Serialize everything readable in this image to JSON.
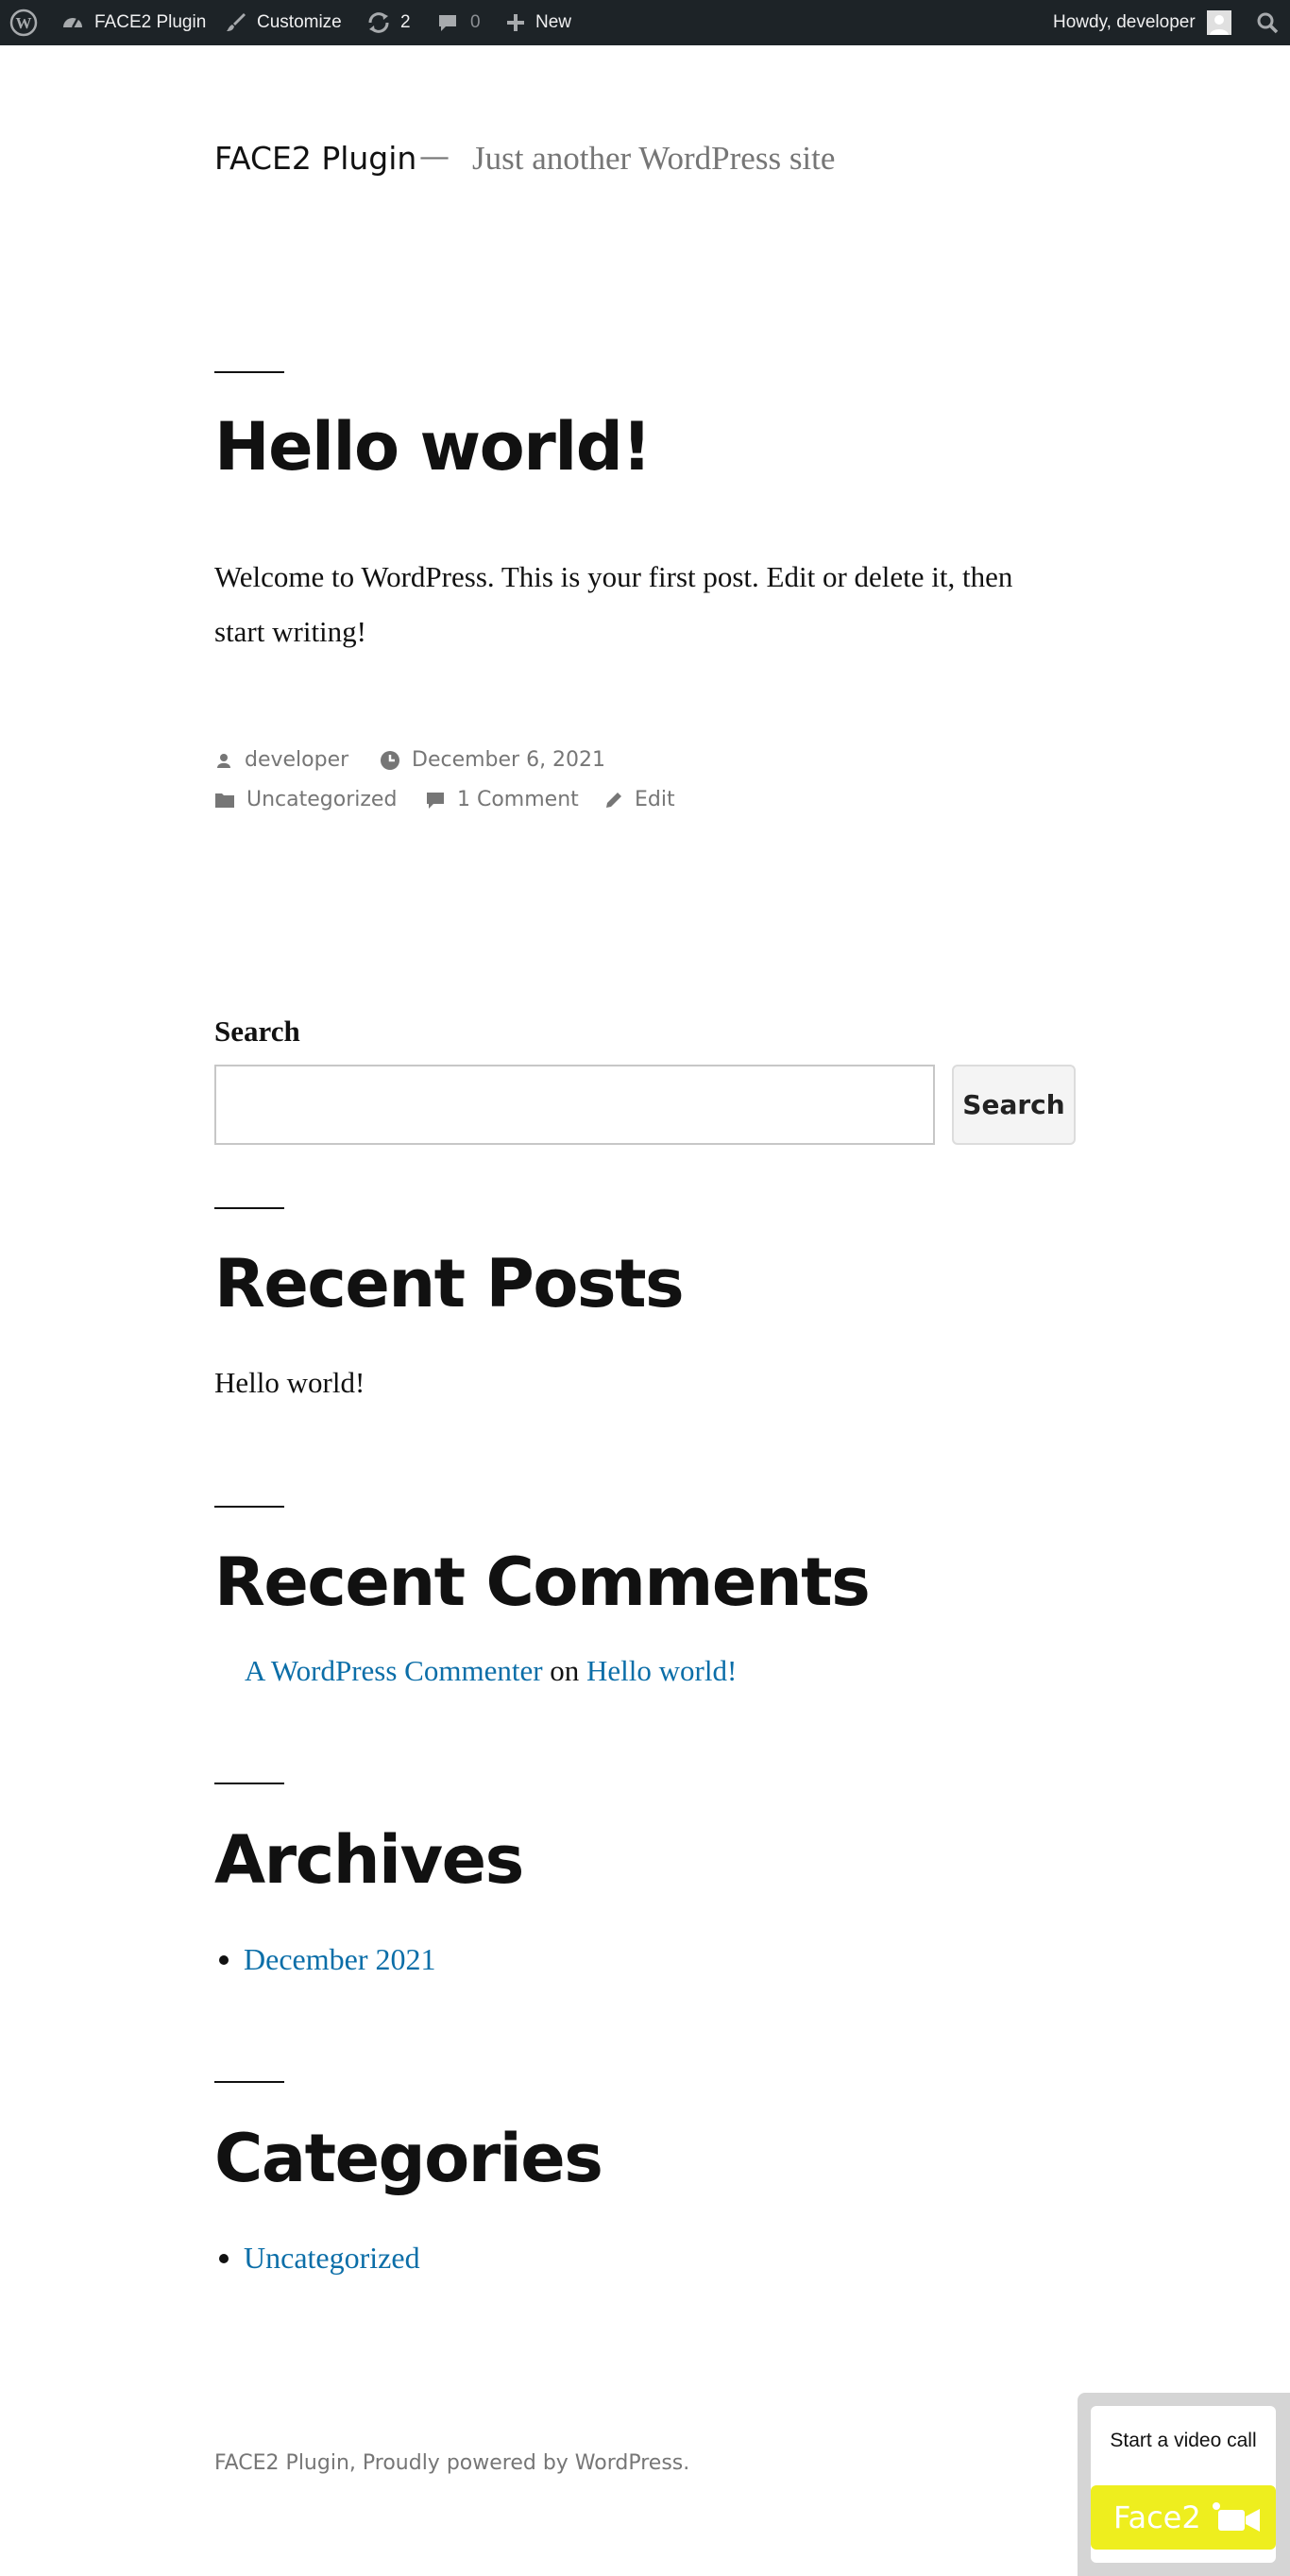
{
  "adminbar": {
    "site_name": "FACE2 Plugin",
    "customize": "Customize",
    "updates_count": "2",
    "comments_count": "0",
    "new_label": "New",
    "howdy": "Howdy, developer"
  },
  "site": {
    "title": "FACE2 Plugin",
    "separator": "—",
    "description": "Just another WordPress site"
  },
  "post": {
    "title": "Hello world!",
    "body": "Welcome to WordPress. This is your first post. Edit or delete it, then start writing!",
    "author": "developer",
    "date": "December 6, 2021",
    "category": "Uncategorized",
    "comments": "1 Comment",
    "edit": "Edit"
  },
  "search_widget": {
    "label": "Search",
    "button": "Search",
    "value": ""
  },
  "recent_posts": {
    "title": "Recent Posts",
    "items": [
      "Hello world!"
    ]
  },
  "recent_comments": {
    "title": "Recent Comments",
    "author": "A WordPress Commenter",
    "on": "on",
    "post": "Hello world!"
  },
  "archives": {
    "title": "Archives",
    "items": [
      "December 2021"
    ]
  },
  "categories": {
    "title": "Categories",
    "items": [
      "Uncategorized"
    ]
  },
  "footer": {
    "text": "FACE2 Plugin, Proudly powered by WordPress."
  },
  "face2": {
    "prompt": "Start a video call",
    "button": "Face2"
  },
  "colors": {
    "admin_bar": "#1d2327",
    "link": "#0b6ea8",
    "face2_yellow": "#eeee1e"
  },
  "icons": {
    "wp_logo": "wordpress-icon",
    "dashboard": "dashboard-icon",
    "customize": "brush-icon",
    "updates": "updates-icon",
    "comments": "comment-icon",
    "new": "plus-icon",
    "avatar": "avatar-icon",
    "search": "search-icon",
    "author": "person-icon",
    "date": "clock-icon",
    "category": "folder-icon",
    "comment_count": "comment-icon",
    "edit": "pencil-icon",
    "video": "video-camera-icon"
  }
}
